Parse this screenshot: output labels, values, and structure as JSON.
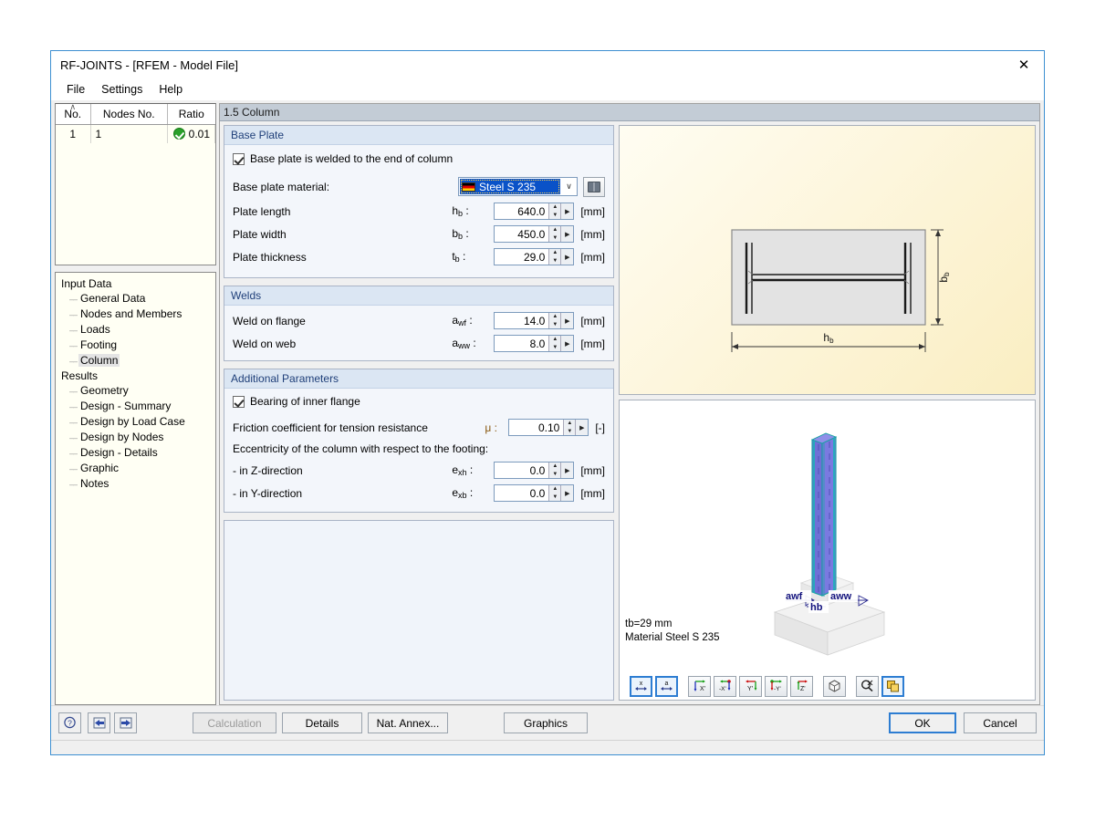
{
  "window": {
    "title": "RF-JOINTS - [RFEM - Model File]",
    "close_label": "✕"
  },
  "menu": [
    "File",
    "Settings",
    "Help"
  ],
  "node_table": {
    "columns": [
      "No.",
      "Nodes No.",
      "Ratio"
    ],
    "sort_caret": "∧",
    "rows": [
      {
        "no": "1",
        "nodes_no": "1",
        "ratio": "0.01",
        "status": "ok"
      }
    ]
  },
  "tree": {
    "groups": [
      {
        "label": "Input Data",
        "items": [
          {
            "label": "General Data",
            "selected": false
          },
          {
            "label": "Nodes and Members",
            "selected": false
          },
          {
            "label": "Loads",
            "selected": false
          },
          {
            "label": "Footing",
            "selected": false
          },
          {
            "label": "Column",
            "selected": true
          }
        ]
      },
      {
        "label": "Results",
        "items": [
          {
            "label": "Geometry",
            "selected": false
          },
          {
            "label": "Design - Summary",
            "selected": false
          },
          {
            "label": "Design by Load Case",
            "selected": false
          },
          {
            "label": "Design by Nodes",
            "selected": false
          },
          {
            "label": "Design - Details",
            "selected": false
          },
          {
            "label": "Graphic",
            "selected": false
          },
          {
            "label": "Notes",
            "selected": false
          }
        ]
      }
    ]
  },
  "pane": {
    "title": "1.5 Column"
  },
  "base_plate": {
    "header": "Base Plate",
    "welded_checkbox": {
      "label": "Base plate is welded to the end of column",
      "checked": true
    },
    "material": {
      "label": "Base plate material:",
      "value": "Steel S 235",
      "flag": "german-flag",
      "dropdown_arrow": "∨"
    },
    "fields": [
      {
        "label": "Plate length",
        "symbol": "h",
        "sub": "b",
        "value": "640.0",
        "unit": "[mm]"
      },
      {
        "label": "Plate width",
        "symbol": "b",
        "sub": "b",
        "value": "450.0",
        "unit": "[mm]"
      },
      {
        "label": "Plate thickness",
        "symbol": "t",
        "sub": "b",
        "value": "29.0",
        "unit": "[mm]"
      }
    ]
  },
  "welds": {
    "header": "Welds",
    "fields": [
      {
        "label": "Weld on flange",
        "symbol": "a",
        "sub": "wf",
        "value": "14.0",
        "unit": "[mm]"
      },
      {
        "label": "Weld on web",
        "symbol": "a",
        "sub": "ww",
        "value": "8.0",
        "unit": "[mm]"
      }
    ]
  },
  "additional": {
    "header": "Additional Parameters",
    "bearing_checkbox": {
      "label": "Bearing of inner flange",
      "checked": true
    },
    "friction": {
      "label": "Friction coefficient for tension resistance",
      "symbol": "μ",
      "value": "0.10",
      "unit": "[-]"
    },
    "eccentricity_note": "Eccentricity of the column with respect to the footing:",
    "fields": [
      {
        "label": "- in Z-direction",
        "symbol": "e",
        "sub": "xh",
        "value": "0.0",
        "unit": "[mm]"
      },
      {
        "label": "- in Y-direction",
        "symbol": "e",
        "sub": "xb",
        "value": "0.0",
        "unit": "[mm]"
      }
    ]
  },
  "plan_view": {
    "dim_horizontal": "h",
    "dim_horizontal_sub": "b",
    "dim_vertical": "b",
    "dim_vertical_sub": "b",
    "plate_fill": "#e3e3e3",
    "background": "#fdf6dd"
  },
  "view_3d": {
    "labels": {
      "flange_weld": "awf",
      "web_weld": "aww",
      "plate_height": "hb"
    },
    "info_line1": "tb=29 mm",
    "info_line2": "Material Steel S 235",
    "column_color": "#6b6bd8",
    "edge_color": "#13a0a0",
    "footing_color": "#e8e8e8"
  },
  "graphics_toolbar": [
    {
      "name": "dimension-x-button",
      "glyph": "x",
      "active": true
    },
    {
      "name": "dimension-a-button",
      "glyph": "a",
      "active": true
    },
    {
      "name": "view-x-button",
      "glyph": "X'",
      "active": false
    },
    {
      "name": "view-negative-x-button",
      "glyph": "-X'",
      "active": false
    },
    {
      "name": "view-y-button",
      "glyph": "Y'",
      "active": false
    },
    {
      "name": "view-negative-y-button",
      "glyph": "-Y'",
      "active": false
    },
    {
      "name": "view-z-button",
      "glyph": "Z'",
      "active": false
    },
    {
      "name": "isometric-view-button",
      "glyph": "cube",
      "active": false
    },
    {
      "name": "zoom-button",
      "glyph": "magnifier",
      "active": false
    },
    {
      "name": "render-mode-button",
      "glyph": "layers",
      "active": true
    }
  ],
  "footer": {
    "help_icon": "question-mark",
    "prev_icon": "arrow-left",
    "next_icon": "arrow-right",
    "calculation": "Calculation",
    "details": "Details",
    "nat_annex": "Nat. Annex...",
    "graphics": "Graphics",
    "ok": "OK",
    "cancel": "Cancel"
  }
}
